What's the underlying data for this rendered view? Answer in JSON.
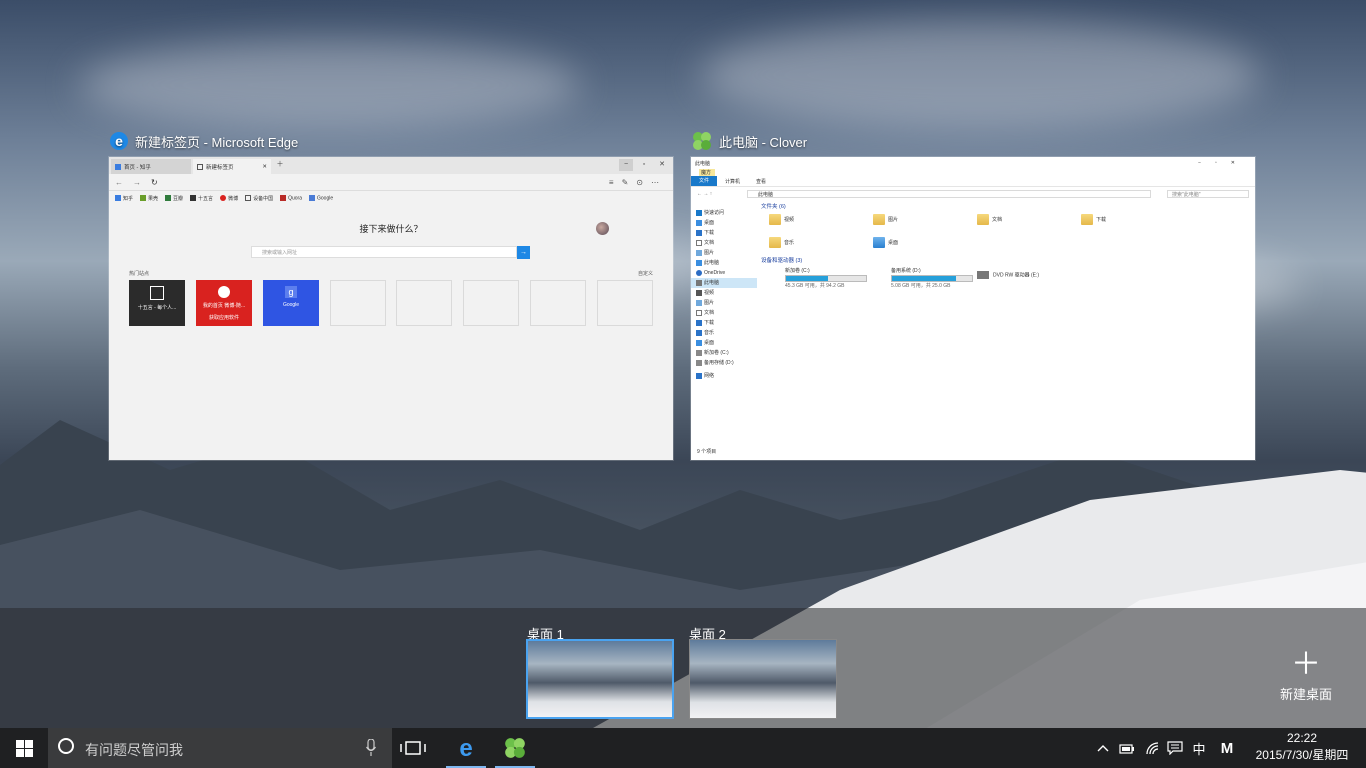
{
  "windows": [
    {
      "title": "新建标签页 - Microsoft Edge",
      "icon": "edge-icon",
      "tabs": [
        "首页 - 知乎",
        "新建标签页"
      ],
      "favorites": [
        "知乎",
        "果壳",
        "豆瓣",
        "十五言",
        "微博",
        "设备中国",
        "Quora",
        "Google"
      ],
      "heading": "接下来做什么？",
      "search_placeholder": "搜索或输入网址",
      "top_sites_label": "热门站点",
      "customize_label": "自定义",
      "tiles": [
        {
          "label": "十五言 - 每个人...",
          "color": "#2b2b2b"
        },
        {
          "label": "我的首页 微博-随...",
          "sub": "获取应用软件",
          "color": "#d9221f"
        },
        {
          "label": "Google",
          "color": "#2f55e3"
        }
      ]
    },
    {
      "title": "此电脑 - Clover",
      "icon": "clover-icon",
      "window_title": "此电脑",
      "quick_access_title": "魔方",
      "ribbon_tabs": [
        "文件",
        "计算机",
        "查看"
      ],
      "address": "此电脑",
      "search_placeholder": "搜索\"此电脑\"",
      "nav": [
        "快速访问",
        "桌面",
        "下载",
        "文档",
        "图片",
        "此电脑",
        "OneDrive",
        "此电脑",
        "视频",
        "图片",
        "文档",
        "下载",
        "音乐",
        "桌面",
        "新加卷 (C:)",
        "备用存储 (D:)",
        "网络"
      ],
      "folders_header": "文件夹 (6)",
      "folders": [
        "视频",
        "图片",
        "文档",
        "下载",
        "音乐",
        "桌面"
      ],
      "devices_header": "设备和驱动器 (3)",
      "drives": [
        {
          "name": "新加卷 (C:)",
          "free": "45.3 GB 可用，共 94.2 GB",
          "used_fraction": 0.52
        },
        {
          "name": "备用系统 (D:)",
          "free": "5.08 GB 可用，共 25.0 GB",
          "used_fraction": 0.8
        },
        {
          "name": "DVD RW 驱动器 (E:)"
        }
      ],
      "status": "9 个项目"
    }
  ],
  "desktops": {
    "items": [
      "桌面 1",
      "桌面 2"
    ],
    "new_desktop_label": "新建桌面"
  },
  "taskbar": {
    "search_placeholder": "有问题尽管问我",
    "ime_label": "中",
    "ime_mode": "M",
    "time": "22:22",
    "date": "2015/7/30/星期四"
  },
  "colors": {
    "accent": "#4aa3f0",
    "taskbar": "#1f2022",
    "edge_blue": "#1e88e5"
  }
}
